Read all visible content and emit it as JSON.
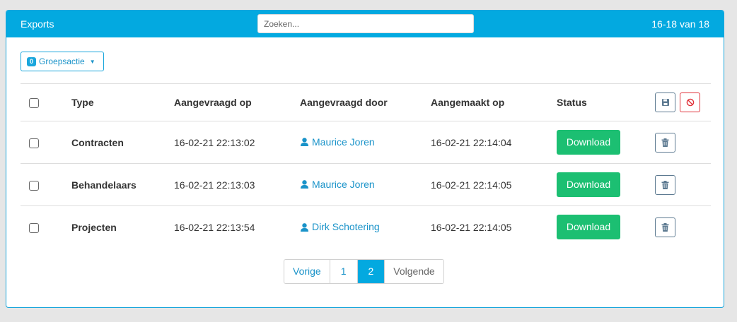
{
  "header": {
    "title": "Exports",
    "search_placeholder": "Zoeken...",
    "range": "16-18 van 18",
    "accent_color": "#03a9e0"
  },
  "group_action": {
    "count": "0",
    "label": "Groepsactie"
  },
  "table": {
    "columns": [
      "Type",
      "Aangevraagd op",
      "Aangevraagd door",
      "Aangemaakt op",
      "Status"
    ],
    "rows": [
      {
        "type": "Contracten",
        "requested_on": "16-02-21 22:13:02",
        "requested_by": "Maurice Joren",
        "created_on": "16-02-21 22:14:04",
        "status": "Download"
      },
      {
        "type": "Behandelaars",
        "requested_on": "16-02-21 22:13:03",
        "requested_by": "Maurice Joren",
        "created_on": "16-02-21 22:14:05",
        "status": "Download"
      },
      {
        "type": "Projecten",
        "requested_on": "16-02-21 22:13:54",
        "requested_by": "Dirk Schotering",
        "created_on": "16-02-21 22:14:05",
        "status": "Download"
      }
    ]
  },
  "pagination": {
    "prev": "Vorige",
    "pages": [
      "1",
      "2"
    ],
    "active_page": "2",
    "next": "Volgende"
  },
  "icons": {
    "save": "save-icon",
    "cancel": "ban-icon",
    "delete": "trash-icon",
    "user": "user-icon"
  },
  "colors": {
    "download": "#1cbf72",
    "link": "#1a93c9",
    "danger": "#e0323a"
  }
}
